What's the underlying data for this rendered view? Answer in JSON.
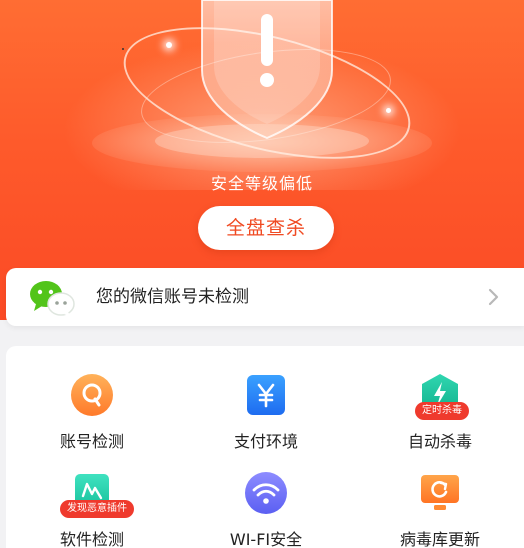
{
  "hero": {
    "safety_level": "安全等级偏低",
    "scan_button": "全盘查杀"
  },
  "wechat": {
    "text": "您的微信账号未检测"
  },
  "features": [
    {
      "label": "账号检测",
      "icon": "magnifier-icon",
      "badge": ""
    },
    {
      "label": "支付环境",
      "icon": "yuan-icon",
      "badge": ""
    },
    {
      "label": "自动杀毒",
      "icon": "lightning-hexagon-icon",
      "badge": "定时杀毒"
    },
    {
      "label": "软件检测",
      "icon": "app-check-icon",
      "badge": "发现恶意插件"
    },
    {
      "label": "WI-FI安全",
      "icon": "wifi-icon",
      "badge": ""
    },
    {
      "label": "病毒库更新",
      "icon": "monitor-refresh-icon",
      "badge": ""
    }
  ],
  "colors": {
    "brand_orange": "#fe5a2b",
    "badge_red": "#ef3a2d",
    "button_text": "#f04a22"
  }
}
